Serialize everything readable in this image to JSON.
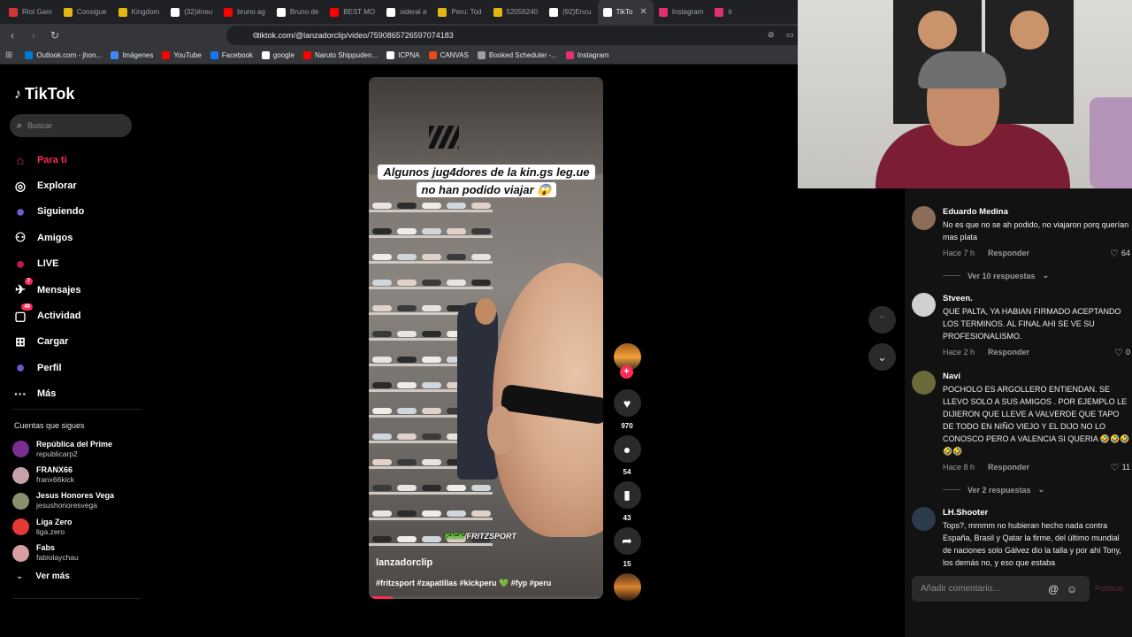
{
  "browser": {
    "tabs": [
      {
        "title": "Riot Gam",
        "color": "#d13639"
      },
      {
        "title": "Consigue",
        "color": "#e2b714"
      },
      {
        "title": "Kingdom",
        "color": "#e2b714"
      },
      {
        "title": "(32)#neu",
        "color": "#ffffff"
      },
      {
        "title": "bruno ag",
        "color": "#ff0000"
      },
      {
        "title": "Bruno de",
        "color": "#ffffff"
      },
      {
        "title": "BEST MO",
        "color": "#ff0000"
      },
      {
        "title": "sideral a",
        "color": "#ffffff"
      },
      {
        "title": "Peru: Tod",
        "color": "#e2b714"
      },
      {
        "title": "52056240",
        "color": "#e2b714"
      },
      {
        "title": "(92)Encu",
        "color": "#ffffff"
      },
      {
        "title": "TikTo",
        "color": "#ffffff",
        "active": true
      },
      {
        "title": "Instagram",
        "color": "#e1306c"
      },
      {
        "title": "Ir",
        "color": "#e1306c"
      }
    ],
    "tab_close": "✕",
    "url": "tiktok.com/@lanzadorclip/video/7590865726597074183",
    "bookmarks": [
      {
        "label": "Outlook.com - jhon...",
        "color": "#0078d4"
      },
      {
        "label": "Imágenes",
        "color": "#4285f4"
      },
      {
        "label": "YouTube",
        "color": "#ff0000"
      },
      {
        "label": "Facebook",
        "color": "#1877f2"
      },
      {
        "label": "google",
        "color": "#ffffff"
      },
      {
        "label": "Naruto Shippuden...",
        "color": "#ff0000"
      },
      {
        "label": "ICPNA",
        "color": "#ffffff"
      },
      {
        "label": "CANVAS",
        "color": "#e64a19"
      },
      {
        "label": "Booked Scheduler -...",
        "color": "#9e9e9e"
      },
      {
        "label": "Instagram",
        "color": "#e1306c"
      }
    ]
  },
  "sidebar": {
    "logo": "TikTok",
    "search_placeholder": "Buscar",
    "nav": [
      {
        "label": "Para ti",
        "icon": "home-icon",
        "glyph": "⌂",
        "active": true
      },
      {
        "label": "Explorar",
        "icon": "compass-icon",
        "glyph": "◎"
      },
      {
        "label": "Siguiendo",
        "icon": "following-icon",
        "glyph": "●"
      },
      {
        "label": "Amigos",
        "icon": "friends-icon",
        "glyph": "⚇"
      },
      {
        "label": "LIVE",
        "icon": "live-icon",
        "glyph": "●"
      },
      {
        "label": "Mensajes",
        "icon": "messages-icon",
        "glyph": "✈",
        "badge": "7"
      },
      {
        "label": "Actividad",
        "icon": "activity-icon",
        "glyph": "▢",
        "badge": "49"
      },
      {
        "label": "Cargar",
        "icon": "upload-icon",
        "glyph": "⊞"
      },
      {
        "label": "Perfil",
        "icon": "profile-icon",
        "glyph": "●"
      },
      {
        "label": "Más",
        "icon": "more-icon",
        "glyph": "···"
      }
    ],
    "following_title": "Cuentas que sigues",
    "following": [
      {
        "name": "República del Prime",
        "handle": "republicarp2",
        "color": "#7a2e8f"
      },
      {
        "name": "FRANX66",
        "handle": "franx66kick",
        "color": "#c8a0a8"
      },
      {
        "name": "Jesus Honores Vega",
        "handle": "jesushonoresvega",
        "color": "#8a8f6c"
      },
      {
        "name": "Liga Zero",
        "handle": "liga.zero",
        "color": "#e53935"
      },
      {
        "name": "Fabs",
        "handle": "fabiolaychau",
        "color": "#d6a0a0"
      }
    ],
    "see_more": "Ver más"
  },
  "video": {
    "caption_line1": "Algunos jug4dores de la kin.gs leg.ue",
    "caption_line2": "no han podido viajar 😱",
    "watermark_a": "KICK",
    "watermark_b": "/FRITZSPORT",
    "username": "lanzadorclip",
    "hashtags": "#fritzsport #zapatillas #kickperu 💚 #fyp #peru",
    "progress": 0.1
  },
  "actions": {
    "likes": "970",
    "comments": "54",
    "saves": "43",
    "shares": "15"
  },
  "comments": {
    "items": [
      {
        "name": "Eduardo Medina",
        "text": "No es que no se ah podido, no viajaron porq querían mas plata",
        "time": "Hace 7 h",
        "reply": "Responder",
        "likes": "64",
        "more": "Ver 10 respuestas",
        "color": "#8c6d5a"
      },
      {
        "name": "Stveen.",
        "text": "QUE PALTA, YA HABIAN FIRMADO ACEPTANDO LOS TERMINOS. AL FINAL AHI SE VE SU PROFESIONALISMO.",
        "time": "Hace 2 h",
        "reply": "Responder",
        "likes": "0",
        "more": "",
        "color": "#d0d0d0"
      },
      {
        "name": "Navi",
        "text": "POCHOLO ES ARGOLLERO ENTIENDAN. SE LLEVO SOLO A SUS AMIGOS . POR EJEMPLO LE DIJIERON QUE LLEVE A VALVERDE QUE TAPO DE TODO EN NIÑO VIEJO Y EL DIJO NO LO CONOSCO PERO A VALENCIA SI QUERIA 🤣🤣🤣🤣🤣",
        "time": "Hace 8 h",
        "reply": "Responder",
        "likes": "11",
        "more": "Ver 2 respuestas",
        "color": "#6b6a3a"
      },
      {
        "name": "LH.Shooter",
        "text": "Tops?, mmmm no hubieran hecho nada contra España, Brasil y Qatar la firme, del último mundial de naciones solo Gálvez dio la talla y por ahí Tony, los demás no, y eso que estaba",
        "time": "",
        "reply": "",
        "likes": "",
        "more": "",
        "color": "#2d3a4a"
      }
    ],
    "input_placeholder": "Añadir comentario...",
    "publish": "Publicar"
  }
}
